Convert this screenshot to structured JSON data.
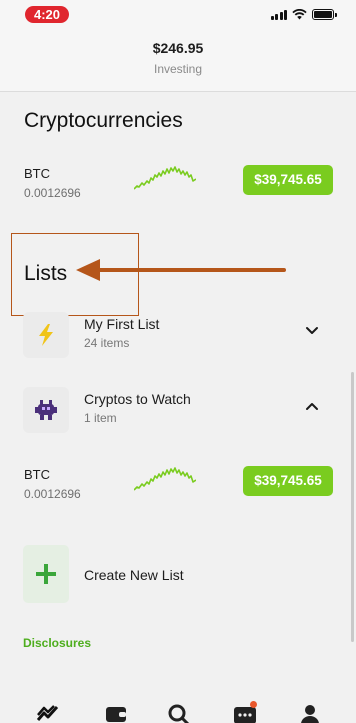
{
  "status_bar": {
    "time": "4:20",
    "icons": [
      "signal-icon",
      "wifi-icon",
      "battery-icon"
    ]
  },
  "header": {
    "amount": "$246.95",
    "subtitle": "Investing"
  },
  "crypto_section": {
    "title": "Cryptocurrencies",
    "items": [
      {
        "symbol": "BTC",
        "quantity": "0.0012696",
        "price": "$39,745.65"
      }
    ]
  },
  "lists_section": {
    "title": "Lists",
    "lists": [
      {
        "name": "My First List",
        "count": "24 items",
        "icon": "lightning-icon",
        "expanded": false
      },
      {
        "name": "Cryptos to Watch",
        "count": "1 item",
        "icon": "alien-icon",
        "expanded": true,
        "items": [
          {
            "symbol": "BTC",
            "quantity": "0.0012696",
            "price": "$39,745.65"
          }
        ]
      }
    ],
    "create_label": "Create New List"
  },
  "disclosures_label": "Disclosures",
  "tab_bar": {
    "tabs": [
      "chart-icon",
      "wallet-icon",
      "search-icon",
      "messages-icon",
      "account-icon"
    ]
  },
  "colors": {
    "accent_green": "#7acc1f",
    "link_green": "#4eae1e",
    "annotation": "#b5561a",
    "time_pill": "#e0262e"
  }
}
